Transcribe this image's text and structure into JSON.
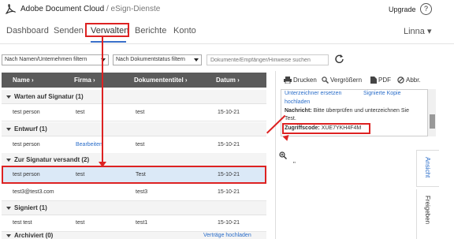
{
  "header": {
    "app_title": "Adobe Document Cloud",
    "app_subtitle": " / eSign-Dienste",
    "upgrade": "Upgrade",
    "help": "?"
  },
  "nav": {
    "items": [
      "Dashboard",
      "Senden",
      "Verwalten",
      "Berichte",
      "Konto"
    ],
    "active": "Verwalten",
    "user": "Linna ▾"
  },
  "filters": {
    "name_filter": "Nach Namen/Unternehmen filtern",
    "status_filter": "Nach Dokumentstatus filtern",
    "search_placeholder": "Dokumente/Empfänger/Hinweise suchen"
  },
  "table": {
    "columns": [
      "Name ›",
      "Firma ›",
      "Dokumententitel ›",
      "Datum ›"
    ],
    "groups": [
      {
        "label": "Warten auf Signatur (1)",
        "rows": [
          {
            "name": "test person",
            "firma": "test",
            "titel": "test",
            "datum": "15-10-21"
          }
        ]
      },
      {
        "label": "Entwurf (1)",
        "rows": [
          {
            "name": "test person",
            "firma": "Bearbeiten",
            "titel": "test",
            "datum": "15-10-21"
          }
        ]
      },
      {
        "label": "Zur Signatur versandt (2)",
        "rows": [
          {
            "name": "test person",
            "firma": "test",
            "titel": "Test",
            "datum": "15-10-21"
          },
          {
            "name": "test3@test3.com",
            "firma": "",
            "titel": "test3",
            "datum": "15-10-21"
          }
        ]
      },
      {
        "label": "Signiert (1)",
        "rows": [
          {
            "name": "test test",
            "firma": "test",
            "titel": "test1",
            "datum": "15-10-21"
          }
        ]
      },
      {
        "label": "Archiviert (0)",
        "rows": []
      }
    ],
    "upload_link": "Verträge hochladen"
  },
  "panel": {
    "toolbar": {
      "print": "Drucken",
      "zoom": "Vergrößern",
      "pdf": "PDF",
      "cancel": "Abbr."
    },
    "info": {
      "link_replace": "Unterzeichner ersetzen",
      "link_signed": "Signierte Kopie",
      "link_upload": "hochladen",
      "message_label": "Nachricht:",
      "message_text": "Bitte überprüfen und unterzeichnen Sie",
      "message_text2": "Test.",
      "code_label": "Zugriffscode:",
      "code_value": "XUE7YKH4F4M"
    },
    "preview_text": "\"",
    "tabs": [
      "Ansicht",
      "Freigeben"
    ]
  },
  "colors": {
    "accent": "#2a6dc9",
    "highlight": "#d22222",
    "header_bg": "#5b5b5b",
    "selected_row": "#dbe9f7"
  }
}
